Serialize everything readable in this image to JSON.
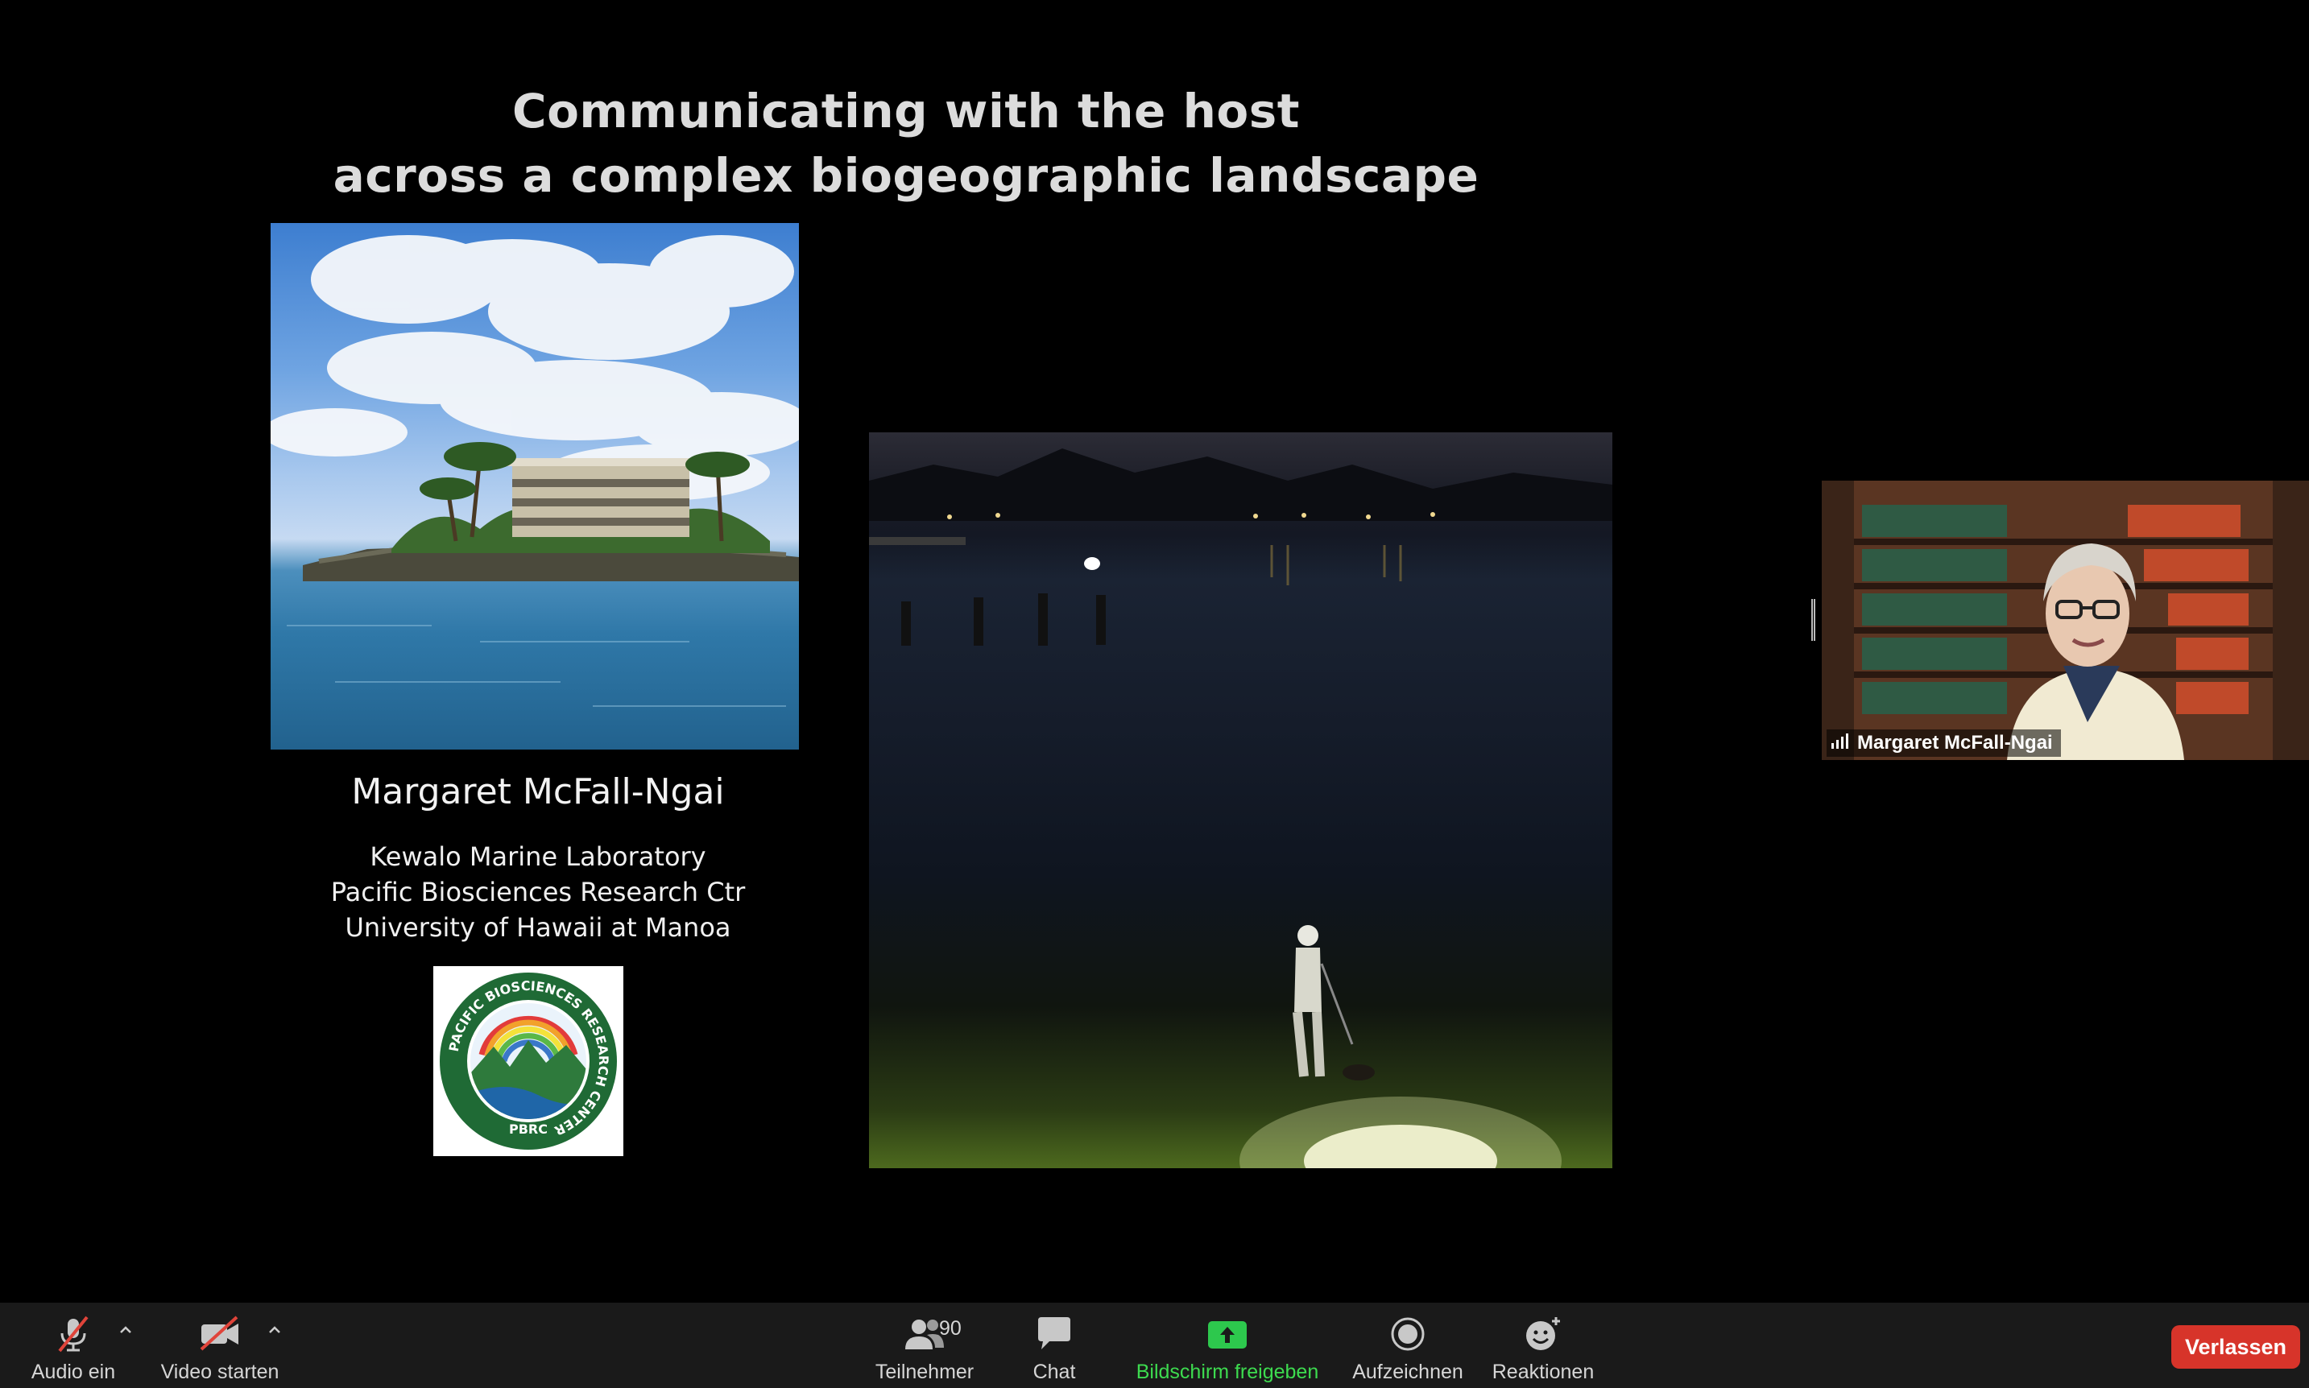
{
  "slide": {
    "title_line1": "Communicating with the host",
    "title_line2": "across a complex biogeographic landscape",
    "speaker_name": "Margaret McFall-Ngai",
    "affiliations": [
      "Kewalo Marine Laboratory",
      "Pacific Biosciences Research Ctr",
      "University of Hawaii at Manoa"
    ],
    "logo": {
      "ring_text": "PACIFIC BIOSCIENCES RESEARCH CENTER",
      "abbreviation": "PBRC"
    }
  },
  "participant_video": {
    "name": "Margaret McFall-Ngai",
    "signal_icon": "signal-bars-icon"
  },
  "toolbar": {
    "audio_label": "Audio ein",
    "video_label": "Video starten",
    "participants_label": "Teilnehmer",
    "participants_count": "90",
    "chat_label": "Chat",
    "share_label": "Bildschirm freigeben",
    "record_label": "Aufzeichnen",
    "reactions_label": "Reaktionen",
    "leave_label": "Verlassen"
  },
  "colors": {
    "toolbar_bg": "#1a1a1a",
    "share_green": "#3ddb4f",
    "leave_red": "#d7342a",
    "muted_red": "#e0443a"
  }
}
